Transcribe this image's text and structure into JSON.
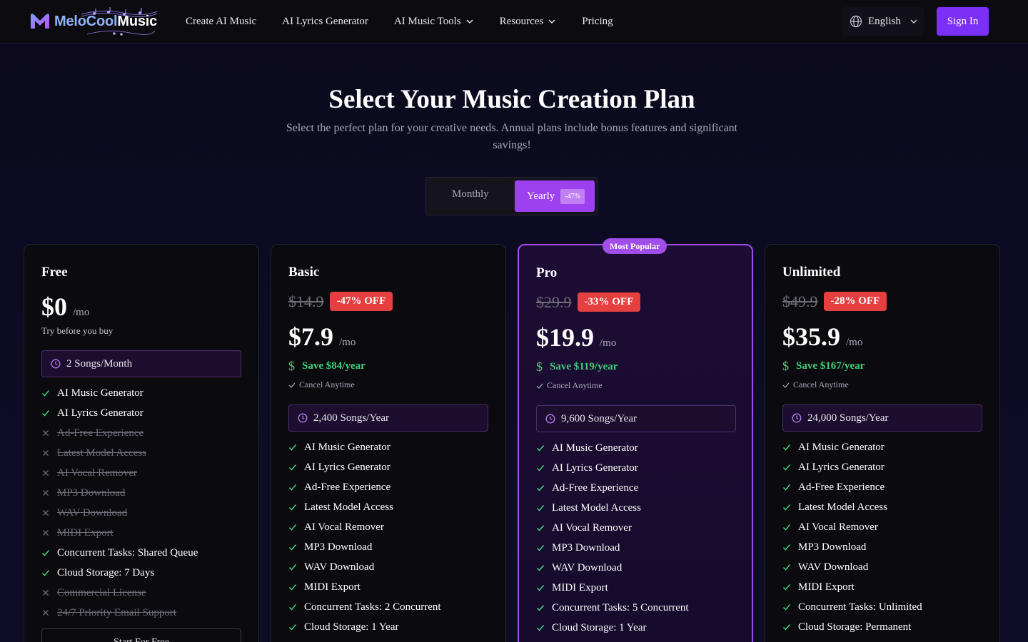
{
  "header": {
    "logo_part1": "MeloCool",
    "logo_part2": "Music",
    "nav": [
      {
        "label": "Create AI Music",
        "dropdown": false
      },
      {
        "label": "AI Lyrics Generator",
        "dropdown": false
      },
      {
        "label": "AI Music Tools",
        "dropdown": true
      },
      {
        "label": "Resources",
        "dropdown": true
      },
      {
        "label": "Pricing",
        "dropdown": false
      }
    ],
    "language": "English",
    "sign_in": "Sign In"
  },
  "hero": {
    "title": "Select Your Music Creation Plan",
    "subtitle": "Select the perfect plan for your creative needs. Annual plans include bonus features and significant savings!"
  },
  "billing_toggle": {
    "monthly": "Monthly",
    "yearly": "Yearly",
    "yearly_badge": "-47%",
    "selected": "Yearly"
  },
  "colors": {
    "accent": "#7b2ff7",
    "popular": "#a14dea",
    "discount": "#e53f3f",
    "save_green": "#3ed07b"
  },
  "plans": [
    {
      "name": "Free",
      "price": "$0",
      "per": "/mo",
      "tagline": "Try before you buy",
      "quota": "2 Songs/Month",
      "features": [
        {
          "label": "AI Music Generator",
          "included": true
        },
        {
          "label": "AI Lyrics Generator",
          "included": true
        },
        {
          "label": "Ad-Free Experience",
          "included": false
        },
        {
          "label": "Latest Model Access",
          "included": false
        },
        {
          "label": "AI Vocal Remover",
          "included": false
        },
        {
          "label": "MP3 Download",
          "included": false
        },
        {
          "label": "WAV Download",
          "included": false
        },
        {
          "label": "MIDI Export",
          "included": false
        },
        {
          "label": "Concurrent Tasks: Shared Queue",
          "included": true
        },
        {
          "label": "Cloud Storage: 7 Days",
          "included": true
        },
        {
          "label": "Commercial License",
          "included": false
        },
        {
          "label": "24/7 Priority Email Support",
          "included": false
        }
      ],
      "button": "Start For Free"
    },
    {
      "name": "Basic",
      "original_price": "$14.9",
      "discount": "-47% OFF",
      "price": "$7.9",
      "per": "/mo",
      "save": "Save $84/year",
      "cancel": "Cancel Anytime",
      "quota": "2,400 Songs/Year",
      "features": [
        {
          "label": "AI Music Generator",
          "included": true
        },
        {
          "label": "AI Lyrics Generator",
          "included": true
        },
        {
          "label": "Ad-Free Experience",
          "included": true
        },
        {
          "label": "Latest Model Access",
          "included": true
        },
        {
          "label": "AI Vocal Remover",
          "included": true
        },
        {
          "label": "MP3 Download",
          "included": true
        },
        {
          "label": "WAV Download",
          "included": true
        },
        {
          "label": "MIDI Export",
          "included": true
        },
        {
          "label": "Concurrent Tasks: 2 Concurrent",
          "included": true
        },
        {
          "label": "Cloud Storage: 1 Year",
          "included": true
        }
      ]
    },
    {
      "name": "Pro",
      "popular": "Most Popular",
      "original_price": "$29.9",
      "discount": "-33% OFF",
      "price": "$19.9",
      "per": "/mo",
      "save": "Save $119/year",
      "cancel": "Cancel Anytime",
      "quota": "9,600 Songs/Year",
      "features": [
        {
          "label": "AI Music Generator",
          "included": true
        },
        {
          "label": "AI Lyrics Generator",
          "included": true
        },
        {
          "label": "Ad-Free Experience",
          "included": true
        },
        {
          "label": "Latest Model Access",
          "included": true
        },
        {
          "label": "AI Vocal Remover",
          "included": true
        },
        {
          "label": "MP3 Download",
          "included": true
        },
        {
          "label": "WAV Download",
          "included": true
        },
        {
          "label": "MIDI Export",
          "included": true
        },
        {
          "label": "Concurrent Tasks: 5 Concurrent",
          "included": true
        },
        {
          "label": "Cloud Storage: 1 Year",
          "included": true
        }
      ]
    },
    {
      "name": "Unlimited",
      "original_price": "$49.9",
      "discount": "-28% OFF",
      "price": "$35.9",
      "per": "/mo",
      "save": "Save $167/year",
      "cancel": "Cancel Anytime",
      "quota": "24,000 Songs/Year",
      "features": [
        {
          "label": "AI Music Generator",
          "included": true
        },
        {
          "label": "AI Lyrics Generator",
          "included": true
        },
        {
          "label": "Ad-Free Experience",
          "included": true
        },
        {
          "label": "Latest Model Access",
          "included": true
        },
        {
          "label": "AI Vocal Remover",
          "included": true
        },
        {
          "label": "MP3 Download",
          "included": true
        },
        {
          "label": "WAV Download",
          "included": true
        },
        {
          "label": "MIDI Export",
          "included": true
        },
        {
          "label": "Concurrent Tasks: Unlimited",
          "included": true
        },
        {
          "label": "Cloud Storage: Permanent",
          "included": true
        }
      ]
    }
  ]
}
